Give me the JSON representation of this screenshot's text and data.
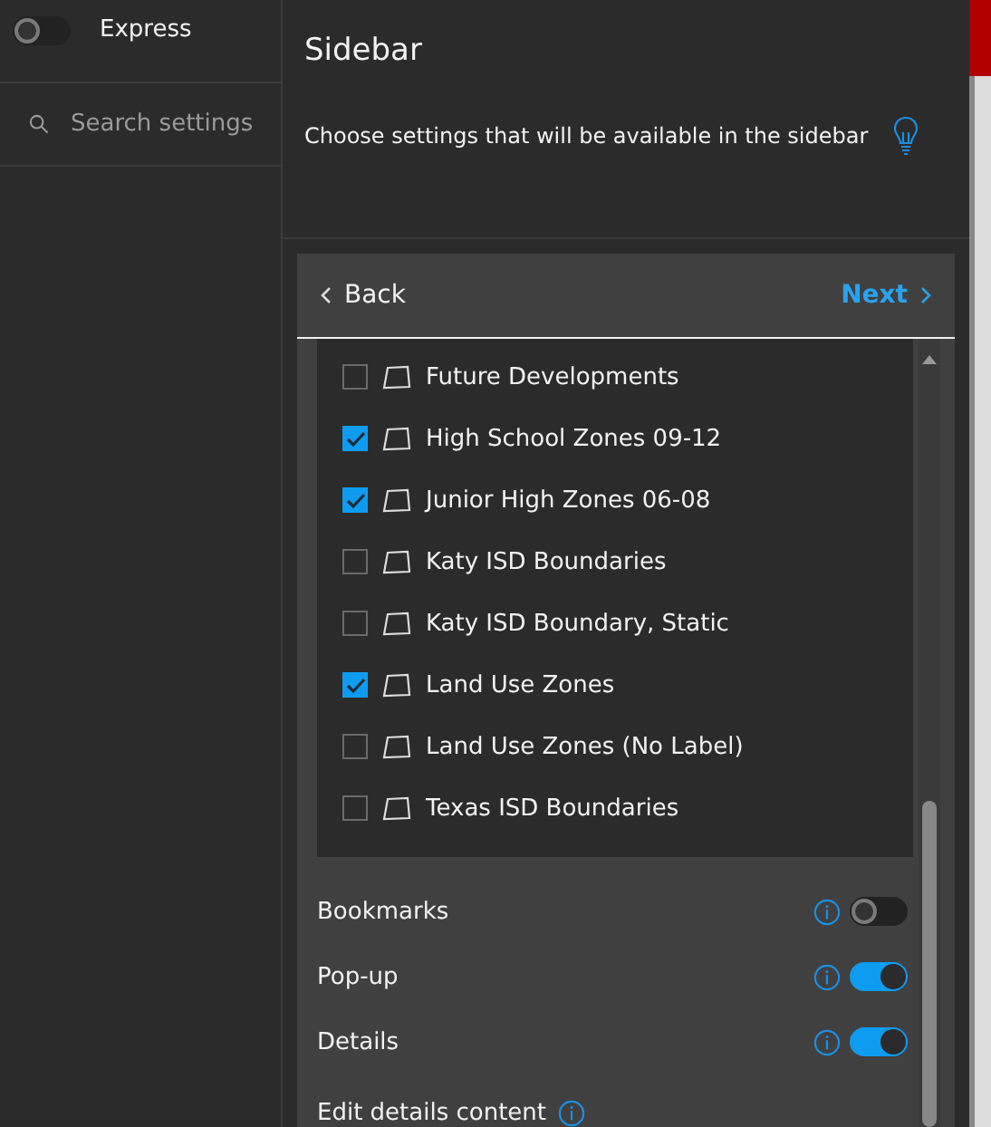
{
  "left_panel": {
    "express": {
      "label": "Express",
      "on": false
    },
    "search": {
      "placeholder": "Search settings"
    }
  },
  "main": {
    "title": "Sidebar",
    "description": "Choose settings that will be available in the sidebar",
    "nav": {
      "back": "Back",
      "next": "Next"
    },
    "layers": [
      {
        "label": "Future Developments",
        "checked": false
      },
      {
        "label": "High School Zones 09-12",
        "checked": true
      },
      {
        "label": "Junior High Zones 06-08",
        "checked": true
      },
      {
        "label": "Katy ISD Boundaries",
        "checked": false
      },
      {
        "label": "Katy ISD Boundary, Static",
        "checked": false
      },
      {
        "label": "Land Use Zones",
        "checked": true
      },
      {
        "label": "Land Use Zones (No Label)",
        "checked": false
      },
      {
        "label": "Texas ISD Boundaries",
        "checked": false
      }
    ],
    "settings": [
      {
        "label": "Bookmarks",
        "on": false
      },
      {
        "label": "Pop-up",
        "on": true
      },
      {
        "label": "Details",
        "on": true
      }
    ],
    "edit_link": {
      "label": "Edit details content"
    }
  }
}
